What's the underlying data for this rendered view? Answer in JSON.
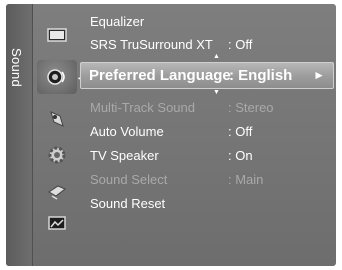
{
  "sidebar": {
    "label": "Sound",
    "icons": [
      "picture-icon",
      "sound-icon",
      "channel-icon",
      "setup-icon",
      "input-icon",
      "application-icon"
    ]
  },
  "menu": {
    "items": [
      {
        "label": "Equalizer",
        "value": "",
        "state": "enabled"
      },
      {
        "label": "SRS TruSurround XT",
        "value": ": Off",
        "state": "enabled"
      },
      {
        "label": "Preferred Language",
        "value": ": English",
        "state": "selected"
      },
      {
        "label": "Multi-Track Sound",
        "value": ": Stereo",
        "state": "disabled"
      },
      {
        "label": "Auto Volume",
        "value": ": Off",
        "state": "enabled"
      },
      {
        "label": "TV Speaker",
        "value": ": On",
        "state": "enabled"
      },
      {
        "label": "Sound Select",
        "value": ": Main",
        "state": "disabled"
      },
      {
        "label": "Sound Reset",
        "value": "",
        "state": "enabled"
      }
    ],
    "selected_arrow": "►",
    "scroll_up": "▲",
    "scroll_down": "▼"
  },
  "colors": {
    "panel": "#787878",
    "selected_bar": "#a6a6a6",
    "text": "#ffffff",
    "disabled_text": "#a9a9a9"
  }
}
